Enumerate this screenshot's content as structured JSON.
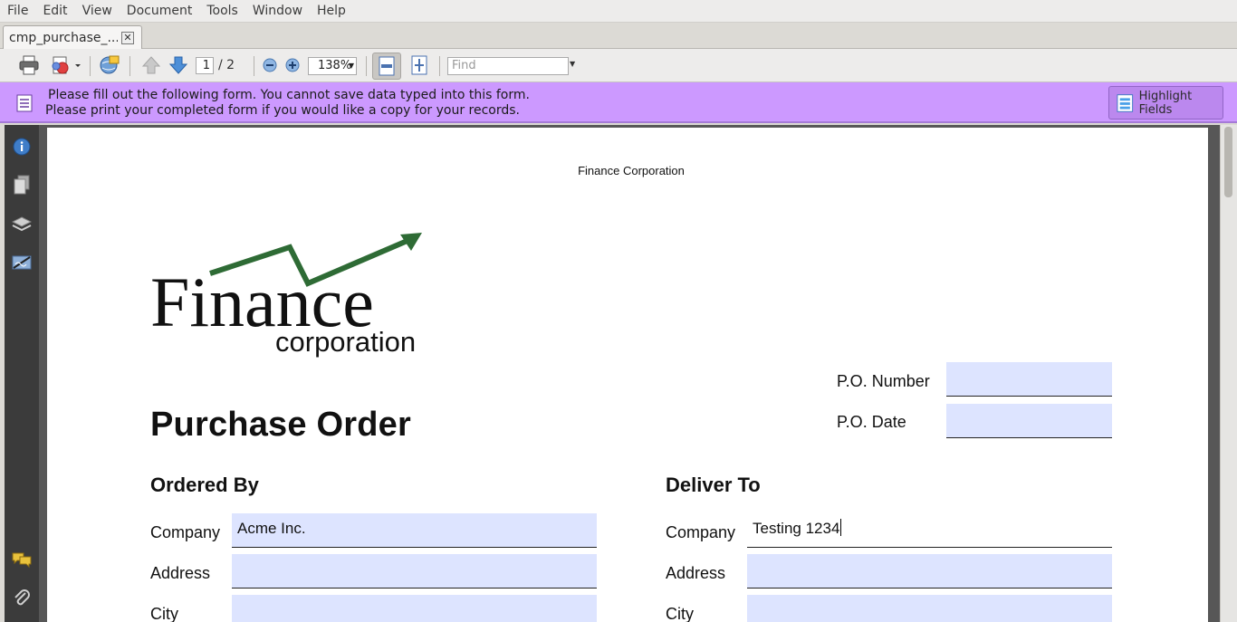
{
  "menubar": {
    "items": [
      "File",
      "Edit",
      "View",
      "Document",
      "Tools",
      "Window",
      "Help"
    ]
  },
  "tab": {
    "title": "cmp_purchase_...",
    "close": "✕"
  },
  "toolbar": {
    "current_page": "1",
    "page_total": "/ 2",
    "zoom": "138%",
    "find_placeholder": "Find"
  },
  "notification": {
    "line1": "Please fill out the following form. You cannot save data typed into this form.",
    "line2": "Please print your completed form if you would like a copy for your records.",
    "highlight_button": "Highlight Fields",
    "bg_color": "#cc99ff"
  },
  "document": {
    "header": "Finance Corporation",
    "logo": {
      "word": "Finance",
      "sub": "corporation",
      "arrow_color": "#2e6b35"
    },
    "po_number_label": "P.O. Number",
    "po_number_value": "",
    "po_date_label": "P.O. Date",
    "po_date_value": "",
    "title": "Purchase Order",
    "ordered_by": {
      "heading": "Ordered By",
      "company_label": "Company",
      "company_value": "Acme Inc.",
      "address_label": "Address",
      "address_value": "",
      "city_label": "City",
      "city_value": ""
    },
    "deliver_to": {
      "heading": "Deliver To",
      "company_label": "Company",
      "company_value": "Testing 1234",
      "address_label": "Address",
      "address_value": "",
      "city_label": "City",
      "city_value": ""
    },
    "field_color": "#dde4ff"
  }
}
